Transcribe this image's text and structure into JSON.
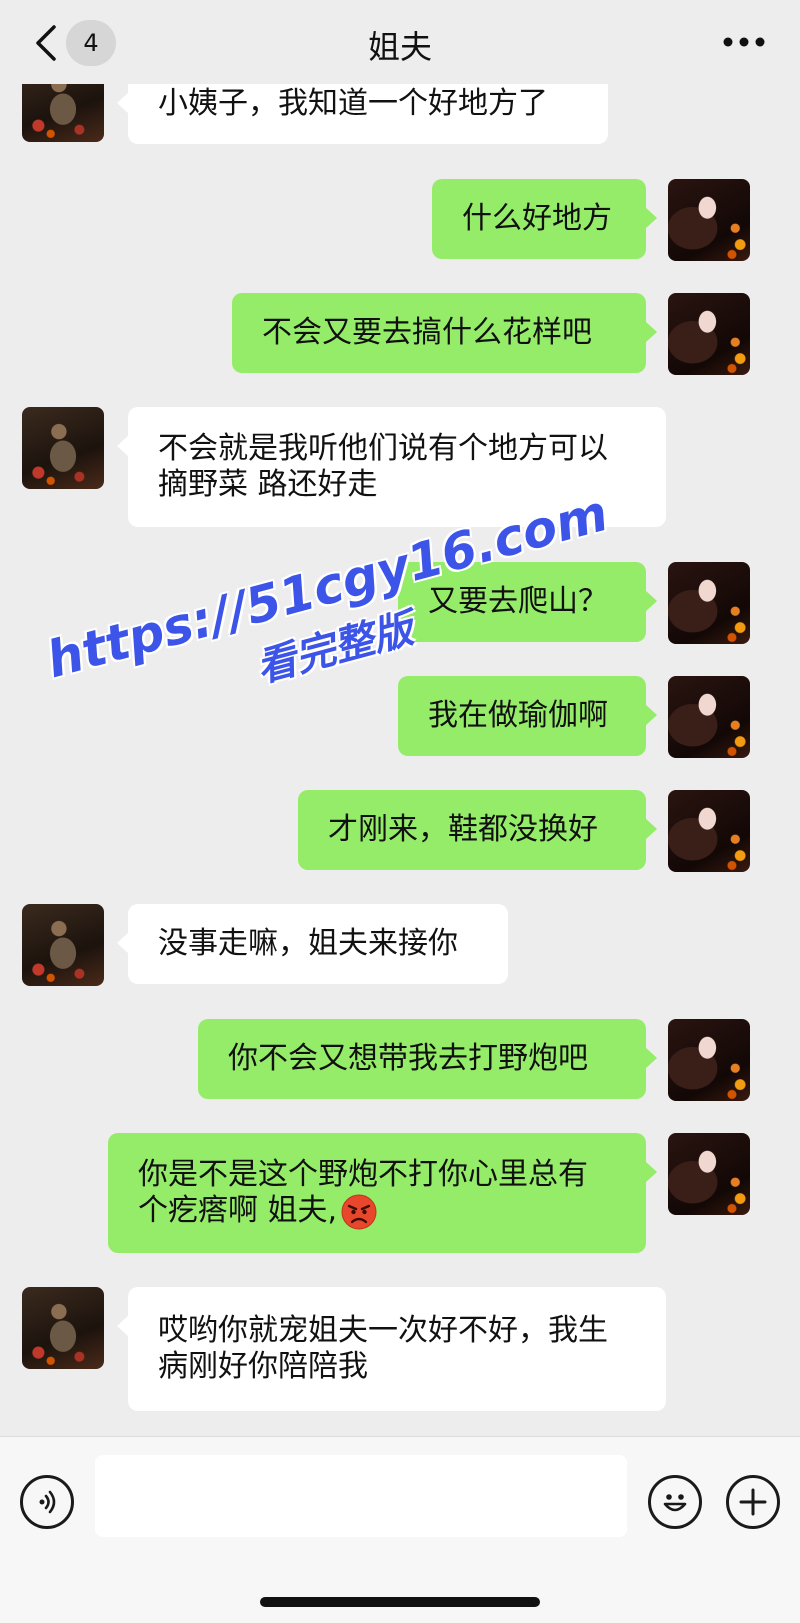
{
  "nav": {
    "back_count": "4",
    "title": "姐夫",
    "more": "•••"
  },
  "messages": [
    {
      "side": "in",
      "text": "小姨子，我知道一个好地方了"
    },
    {
      "side": "out",
      "text": "什么好地方"
    },
    {
      "side": "out",
      "text": "不会又要去搞什么花样吧"
    },
    {
      "side": "in",
      "text": "不会就是我听他们说有个地方可以摘野菜 路还好走"
    },
    {
      "side": "out",
      "text": "又要去爬山？"
    },
    {
      "side": "out",
      "text": "我在做瑜伽啊"
    },
    {
      "side": "out",
      "text": "才刚来，鞋都没换好"
    },
    {
      "side": "in",
      "text": "没事走嘛，姐夫来接你"
    },
    {
      "side": "out",
      "text": "你不会又想带我去打野炮吧"
    },
    {
      "side": "out",
      "text": "你是不是这个野炮不打你心里总有个疙瘩啊 姐夫,",
      "emoji": "angry-face-icon"
    },
    {
      "side": "in",
      "text": "哎哟你就宠姐夫一次好不好，我生病刚好你陪陪我"
    }
  ],
  "watermark": {
    "line1": "https://51cgy16.com",
    "line2": "看完整版"
  },
  "input": {
    "value": "",
    "placeholder": ""
  },
  "colors": {
    "background": "#ededed",
    "outgoing_bubble": "#95ec69",
    "incoming_bubble": "#ffffff",
    "watermark": "#3c55e8"
  }
}
